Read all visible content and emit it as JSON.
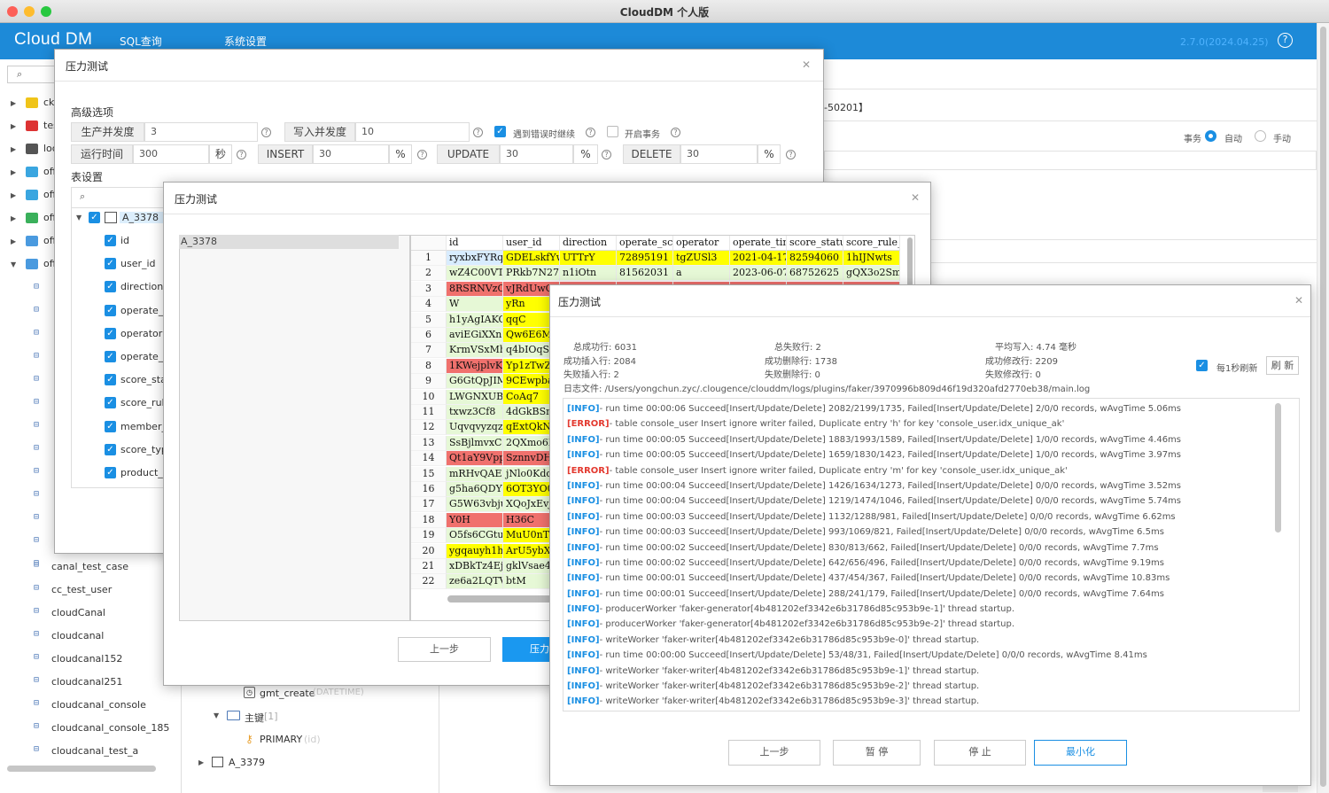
{
  "window": {
    "title": "CloudDM 个人版"
  },
  "app": {
    "logo": "Cloud DM",
    "nav": [
      "SQL查询",
      "系统设置"
    ],
    "version": "2.7.0(2024.04.25)",
    "help": "?"
  },
  "bg": {
    "conn": "-50201】",
    "tx_label": "事务",
    "tx_auto": "自动",
    "tx_manual": "手动"
  },
  "left": {
    "dbs": [
      "ck",
      "tes",
      "loc",
      "off",
      "off",
      "off",
      "off",
      "off"
    ],
    "tables": [
      "canal_test_case",
      "cc_test_user",
      "cloudCanal",
      "cloudcanal",
      "cloudcanal152",
      "cloudcanal251",
      "cloudcanal_console",
      "cloudcanal_console_185",
      "cloudcanal_test_a"
    ]
  },
  "midtree": {
    "col": "gmt_create",
    "col_type": "(DATETIME)",
    "pk_folder": "主键",
    "pk_count": "[1]",
    "pk": "PRIMARY",
    "pk_cols": "(id)",
    "next_table": "A_3379"
  },
  "d1": {
    "title": "压力测试",
    "adv": "高级选项",
    "row1": [
      {
        "label": "生产并发度",
        "value": "3"
      },
      {
        "label": "写入并发度",
        "value": "10"
      }
    ],
    "continue_on_error": "遇到错误时继续",
    "open_tx": "开启事务",
    "runtime_label": "运行时间",
    "runtime": "300",
    "sec": "秒",
    "ops": [
      {
        "label": "INSERT",
        "value": "30",
        "unit": "%"
      },
      {
        "label": "UPDATE",
        "value": "30",
        "unit": "%"
      },
      {
        "label": "DELETE",
        "value": "30",
        "unit": "%"
      }
    ],
    "table_settings": "表设置",
    "table": "A_3378",
    "columns": [
      "id",
      "user_id",
      "direction",
      "operate_s",
      "operator",
      "operate_ti",
      "score_sta",
      "score_rule",
      "member_l",
      "score_typ",
      "product_i"
    ]
  },
  "d2": {
    "title": "压力测试",
    "table": "A_3378",
    "prev": "上一步",
    "start": "压力",
    "headers": [
      "id",
      "user_id",
      "direction",
      "operate_score",
      "operator",
      "operate_time",
      "score_status",
      "score_rule_id"
    ],
    "rows": [
      [
        "1",
        "ryxbxFYRqI",
        "GDELskfYw",
        "UTTrY",
        "72895191",
        "tgZUSl3",
        "2021-04-17 (",
        "82594060",
        "1hIJNwts"
      ],
      [
        "2",
        "wZ4C00VTV",
        "PRkb7N27IC",
        "n1iOtn",
        "81562031",
        "a",
        "2023-06-07 2",
        "68752625",
        "gQX3o2Sme"
      ],
      [
        "3",
        "8RSRNVzCh",
        "vJRdUwC",
        "",
        "",
        "",
        "",
        "",
        ""
      ],
      [
        "4",
        "W",
        "yRn",
        "",
        "",
        "",
        "",
        "",
        ""
      ],
      [
        "5",
        "h1yAgIAKO",
        "qqC",
        "",
        "",
        "",
        "",
        "",
        ""
      ],
      [
        "6",
        "aviEGiXXn8",
        "Qw6E6M5",
        "",
        "",
        "",
        "",
        "",
        ""
      ],
      [
        "7",
        "KrmVSxMh7",
        "q4bIOqSz",
        "",
        "",
        "",
        "",
        "",
        ""
      ],
      [
        "8",
        "1KWejplvKU",
        "Yp1zTwZI",
        "",
        "",
        "",
        "",
        "",
        ""
      ],
      [
        "9",
        "G6GtQpJIM",
        "9CEwpba",
        "",
        "",
        "",
        "",
        "",
        ""
      ],
      [
        "10",
        "LWGNXUBc",
        "CoAq7",
        "",
        "",
        "",
        "",
        "",
        ""
      ],
      [
        "11",
        "txwz3Cf8",
        "4dGkBSm",
        "",
        "",
        "",
        "",
        "",
        ""
      ],
      [
        "12",
        "Uqvqvyzqz0",
        "qExtQkNc",
        "",
        "",
        "",
        "",
        "",
        ""
      ],
      [
        "13",
        "SsBjlmvxCL",
        "2QXmo6L",
        "",
        "",
        "",
        "",
        "",
        ""
      ],
      [
        "14",
        "Qt1aY9Vpp",
        "SznnvDHk",
        "",
        "",
        "",
        "",
        "",
        ""
      ],
      [
        "15",
        "mRHvQAEP",
        "jNlo0Kdq",
        "",
        "",
        "",
        "",
        "",
        ""
      ],
      [
        "16",
        "g5ha6QDYN",
        "6OT3YO0",
        "",
        "",
        "",
        "",
        "",
        ""
      ],
      [
        "17",
        "G5W63vbju",
        "XQoJxEvJ",
        "",
        "",
        "",
        "",
        "",
        ""
      ],
      [
        "18",
        "Y0H",
        "H36C",
        "",
        "",
        "",
        "",
        "",
        ""
      ],
      [
        "19",
        "O5fs6CGtus",
        "MuU0nT7",
        "",
        "",
        "",
        "",
        "",
        ""
      ],
      [
        "20",
        "ygqauyh1hw",
        "ArU5ybX",
        "",
        "",
        "",
        "",
        "",
        ""
      ],
      [
        "21",
        "xDBkTz4Ejz",
        "gklVsae42",
        "",
        "",
        "",
        "",
        "",
        ""
      ],
      [
        "22",
        "ze6a2LQTVl",
        "btM",
        "",
        "",
        "",
        "",
        "",
        ""
      ]
    ]
  },
  "d3": {
    "title": "压力测试",
    "stats": [
      [
        "总成功行: 6031",
        "总失败行: 2",
        "平均写入: 4.74 毫秒"
      ],
      [
        "成功插入行: 2084",
        "成功删除行: 1738",
        "成功修改行: 2209"
      ],
      [
        "失败插入行: 2",
        "失败删除行: 0",
        "失败修改行: 0"
      ]
    ],
    "logfile": "日志文件: /Users/yongchun.zyc/.clougence/clouddm/logs/plugins/faker/3970996b809d46f19d320afd2770eb38/main.log",
    "refresh_cb": "每1秒刷新",
    "refresh_btn": "刷 新",
    "log": [
      [
        "[INFO]",
        "- run time 00:00:06 Succeed[Insert/Update/Delete] 2082/2199/1735, Failed[Insert/Update/Delete] 2/0/0 records, wAvgTime 5.06ms"
      ],
      [
        "[ERROR]",
        "- table console_user Insert ignore writer failed, Duplicate entry 'h' for key 'console_user.idx_unique_ak'"
      ],
      [
        "[INFO]",
        "- run time 00:00:05 Succeed[Insert/Update/Delete] 1883/1993/1589, Failed[Insert/Update/Delete] 1/0/0 records, wAvgTime 4.46ms"
      ],
      [
        "[INFO]",
        "- run time 00:00:05 Succeed[Insert/Update/Delete] 1659/1830/1423, Failed[Insert/Update/Delete] 1/0/0 records, wAvgTime 3.97ms"
      ],
      [
        "[ERROR]",
        "- table console_user Insert ignore writer failed, Duplicate entry 'm' for key 'console_user.idx_unique_ak'"
      ],
      [
        "[INFO]",
        "- run time 00:00:04 Succeed[Insert/Update/Delete] 1426/1634/1273, Failed[Insert/Update/Delete] 0/0/0 records, wAvgTime 3.52ms"
      ],
      [
        "[INFO]",
        "- run time 00:00:04 Succeed[Insert/Update/Delete] 1219/1474/1046, Failed[Insert/Update/Delete] 0/0/0 records, wAvgTime 5.74ms"
      ],
      [
        "[INFO]",
        "- run time 00:00:03 Succeed[Insert/Update/Delete] 1132/1288/981, Failed[Insert/Update/Delete] 0/0/0 records, wAvgTime 6.62ms"
      ],
      [
        "[INFO]",
        "- run time 00:00:03 Succeed[Insert/Update/Delete] 993/1069/821, Failed[Insert/Update/Delete] 0/0/0 records, wAvgTime 6.5ms"
      ],
      [
        "[INFO]",
        "- run time 00:00:02 Succeed[Insert/Update/Delete] 830/813/662, Failed[Insert/Update/Delete] 0/0/0 records, wAvgTime 7.7ms"
      ],
      [
        "[INFO]",
        "- run time 00:00:02 Succeed[Insert/Update/Delete] 642/656/496, Failed[Insert/Update/Delete] 0/0/0 records, wAvgTime 9.19ms"
      ],
      [
        "[INFO]",
        "- run time 00:00:01 Succeed[Insert/Update/Delete] 437/454/367, Failed[Insert/Update/Delete] 0/0/0 records, wAvgTime 10.83ms"
      ],
      [
        "[INFO]",
        "- run time 00:00:01 Succeed[Insert/Update/Delete] 288/241/179, Failed[Insert/Update/Delete] 0/0/0 records, wAvgTime 7.64ms"
      ],
      [
        "[INFO]",
        "- producerWorker 'faker-generator[4b481202ef3342e6b31786d85c953b9e-1]' thread startup."
      ],
      [
        "[INFO]",
        "- producerWorker 'faker-generator[4b481202ef3342e6b31786d85c953b9e-2]' thread startup."
      ],
      [
        "[INFO]",
        "- writeWorker 'faker-writer[4b481202ef3342e6b31786d85c953b9e-0]' thread startup."
      ],
      [
        "[INFO]",
        "- run time 00:00:00 Succeed[Insert/Update/Delete] 53/48/31, Failed[Insert/Update/Delete] 0/0/0 records, wAvgTime 8.41ms"
      ],
      [
        "[INFO]",
        "- writeWorker 'faker-writer[4b481202ef3342e6b31786d85c953b9e-1]' thread startup."
      ],
      [
        "[INFO]",
        "- writeWorker 'faker-writer[4b481202ef3342e6b31786d85c953b9e-2]' thread startup."
      ],
      [
        "[INFO]",
        "- writeWorker 'faker-writer[4b481202ef3342e6b31786d85c953b9e-3]' thread startup."
      ]
    ],
    "buttons": [
      "上一步",
      "暂 停",
      "停 止",
      "最小化"
    ]
  },
  "colors": {
    "brand": "#1d8ad8",
    "yellow": "#ffff00",
    "red": "#f0716d",
    "green": "#e6f8d6",
    "info": "#1a8fe3",
    "error": "#e3392f"
  }
}
